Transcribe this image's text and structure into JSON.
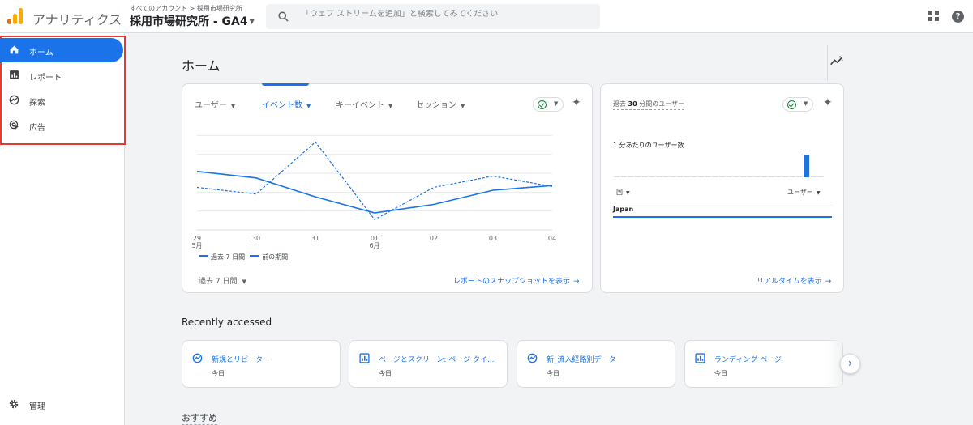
{
  "header": {
    "app_title": "アナリティクス",
    "breadcrumb": "すべてのアカウント > 採用市場研究所",
    "property_name": "採用市場研究所 - GA4",
    "search_placeholder": "「ウェブ ストリームを追加」と検索してみてください"
  },
  "sidebar": {
    "items": [
      {
        "label": "ホーム",
        "icon": "home-icon",
        "active": true
      },
      {
        "label": "レポート",
        "icon": "bar-chart-icon",
        "active": false
      },
      {
        "label": "探索",
        "icon": "explore-icon",
        "active": false
      },
      {
        "label": "広告",
        "icon": "advertising-icon",
        "active": false
      }
    ],
    "admin_label": "管理",
    "highlight_color": "#e53935"
  },
  "main": {
    "title": "ホーム",
    "overview": {
      "tabs": [
        {
          "label": "ユーザー",
          "active": false
        },
        {
          "label": "イベント数",
          "active": true
        },
        {
          "label": "キーイベント",
          "active": false
        },
        {
          "label": "セッション",
          "active": false
        }
      ],
      "date_range": "過去 7 日間",
      "link": "レポートのスナップショットを表示",
      "legend": {
        "current": "過去 7 日間",
        "previous": "前の期間"
      }
    },
    "realtime": {
      "title_prefix": "過去",
      "title_number": "30",
      "title_suffix": "分間のユーザー",
      "per_minute_label": "1 分あたりのユーザー数",
      "col_country": "国",
      "col_users": "ユーザー",
      "row_country": "Japan",
      "link": "リアルタイムを表示"
    },
    "recent": {
      "title": "Recently accessed",
      "items": [
        {
          "label": "新規とリピーター",
          "date": "今日",
          "icon": "explore-icon"
        },
        {
          "label": "ページとスクリーン: ページ タイ...",
          "date": "今日",
          "icon": "bar-chart-icon"
        },
        {
          "label": "新_流入経路別データ",
          "date": "今日",
          "icon": "explore-icon"
        },
        {
          "label": "ランディング ページ",
          "date": "今日",
          "icon": "bar-chart-icon"
        }
      ]
    },
    "recommended_title": "おすすめ"
  },
  "chart_data": [
    {
      "type": "line",
      "categories": [
        "29\n5月",
        "30",
        "31",
        "01\n6月",
        "02",
        "03",
        "04"
      ],
      "series": [
        {
          "name": "過去 7 日間",
          "style": "solid",
          "values": [
            62,
            55,
            35,
            18,
            27,
            42,
            47
          ]
        },
        {
          "name": "前の期間",
          "style": "dashed",
          "values": [
            45,
            38,
            93,
            11,
            45,
            57,
            46
          ]
        }
      ],
      "ylim": [
        0,
        120
      ],
      "grid": true,
      "color": "#1a73e8",
      "legend": "bottom-left"
    },
    {
      "type": "bar",
      "values": [
        0,
        0,
        0,
        0,
        0,
        0,
        0,
        0,
        0,
        0,
        0,
        0,
        0,
        0,
        0,
        0,
        0,
        0,
        0,
        0,
        0,
        0,
        0,
        0,
        0,
        0,
        0,
        1,
        0,
        0
      ],
      "color": "#1a73e8",
      "grid": false
    }
  ]
}
